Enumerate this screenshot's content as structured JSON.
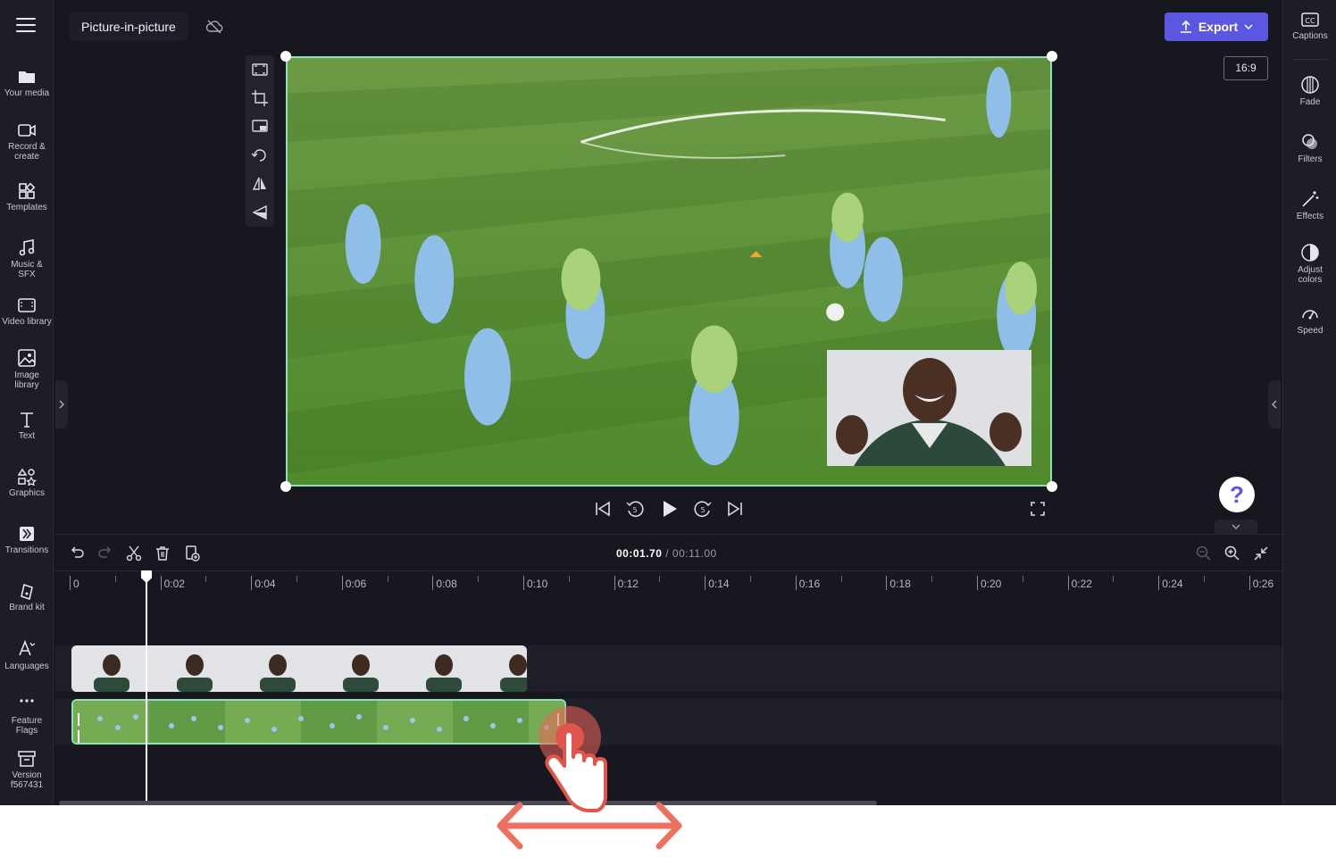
{
  "header": {
    "project_title": "Picture-in-picture",
    "export_label": "Export",
    "aspect_ratio": "16:9"
  },
  "left_nav": [
    {
      "label": "Your media",
      "icon": "folder-icon"
    },
    {
      "label": "Record & create",
      "icon": "camera-icon"
    },
    {
      "label": "Templates",
      "icon": "templates-icon"
    },
    {
      "label": "Music & SFX",
      "icon": "music-icon"
    },
    {
      "label": "Video library",
      "icon": "film-icon"
    },
    {
      "label": "Image library",
      "icon": "image-icon"
    },
    {
      "label": "Text",
      "icon": "text-icon"
    },
    {
      "label": "Graphics",
      "icon": "shapes-icon"
    },
    {
      "label": "Transitions",
      "icon": "transitions-icon"
    },
    {
      "label": "Brand kit",
      "icon": "brand-icon"
    },
    {
      "label": "Languages",
      "icon": "languages-icon"
    },
    {
      "label": "Feature Flags",
      "icon": "more-icon"
    },
    {
      "label": "Version f567431",
      "icon": "archive-icon"
    }
  ],
  "right_nav": [
    {
      "label": "Captions",
      "icon": "cc-icon"
    },
    {
      "label": "Fade",
      "icon": "fade-icon"
    },
    {
      "label": "Filters",
      "icon": "filters-icon"
    },
    {
      "label": "Effects",
      "icon": "wand-icon"
    },
    {
      "label": "Adjust colors",
      "icon": "contrast-icon"
    },
    {
      "label": "Speed",
      "icon": "speedometer-icon"
    }
  ],
  "help": {
    "label": "?"
  },
  "timeline": {
    "current_time": "00:01.70",
    "separator": " / ",
    "total_time": "00:11.00",
    "ruler_labels": [
      "0",
      "0:02",
      "0:04",
      "0:06",
      "0:08",
      "0:10",
      "0:12",
      "0:14",
      "0:16",
      "0:18",
      "0:20",
      "0:22",
      "0:24",
      "0:26"
    ]
  },
  "colors": {
    "accent": "#5b57e0",
    "selection": "#8fe0b8",
    "background": "#17171f",
    "annotation": "#f07060"
  }
}
